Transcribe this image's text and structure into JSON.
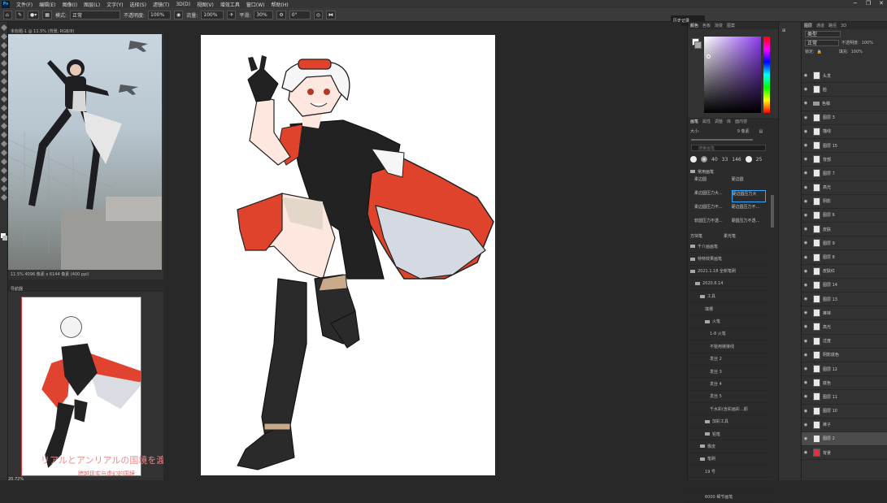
{
  "app": {
    "logo": "Ps"
  },
  "menu": [
    "文件(F)",
    "编辑(E)",
    "图像(I)",
    "图层(L)",
    "文字(Y)",
    "选择(S)",
    "滤镜(T)",
    "3D(D)",
    "视图(V)",
    "增效工具",
    "窗口(W)",
    "帮助(H)"
  ],
  "options": {
    "mode_label": "模式:",
    "mode_value": "正常",
    "opacity_label": "不透明度:",
    "opacity_value": "100%",
    "flow_label": "流量:",
    "flow_value": "100%",
    "smooth_label": "平滑:",
    "smooth_value": "30%",
    "angle_value": "0°"
  },
  "history_button": "历史记录",
  "ref_window": {
    "title": "未标题-1 @ 11.5% (背景, RGB/8)",
    "status": "11.5%   4096 像素 x 6144 像素 (400 ppi)"
  },
  "navigator": {
    "title": "导航器",
    "watermark_line1": "リアルとアンリアルの国境を渡り",
    "watermark_line2": "跨越现实与虚幻的国境",
    "zoom": "20.72%"
  },
  "color_panel": {
    "tabs": [
      "颜色",
      "色板",
      "渐变",
      "图案"
    ]
  },
  "brush_panel": {
    "tabs": [
      "画笔",
      "属性",
      "调整",
      "库",
      "面内容"
    ],
    "size_label": "大小:",
    "size_value": "9 像素",
    "search_placeholder": "搜索画笔",
    "preset_sizes": [
      "",
      "",
      "40",
      "33",
      "146",
      "",
      "25"
    ],
    "folder_top": "常用画笔",
    "grid": [
      "柔边圆",
      "硬边圆",
      "柔边圆压力大...",
      "硬边圆压力大",
      "柔边圆压力不...",
      "硬边圆压力不...",
      "软圆压力不透...",
      "硬圆压力不透..."
    ],
    "row2": [
      "方块笔",
      "柔光笔"
    ],
    "items": [
      "千介画画笔",
      "特特效果画笔",
      "2021.1.18 全新笔刷",
      "2020.6.14",
      "工具",
      "填槽",
      "火笔",
      "1-8 火笔",
      "不能用链接线",
      "发丝 2",
      "发丝 3",
      "发丝 4",
      "发丝 5",
      "千水彩(含彩画彩...颜",
      "加彩工具",
      "铅笔",
      "橡皮",
      "笔刷",
      "19 号",
      "尖涂",
      "6000 细节画笔"
    ]
  },
  "layers": {
    "tabs": [
      "图层",
      "通道",
      "路径",
      "3D"
    ],
    "kind": "类型",
    "blend": "正常",
    "opacity_label": "不透明度:",
    "opacity": "100%",
    "lock_label": "锁定:",
    "fill_label": "填充:",
    "fill": "100%",
    "rows": [
      "头发",
      "脸",
      "色稿",
      "图层 3",
      "描线",
      "图层 15",
      "背部",
      "图层 7",
      "高光",
      "阴影",
      "图层 6",
      "皮肤",
      "图层 9",
      "图层 8",
      "皮肤红",
      "图层 14",
      "图层 13",
      "裤袜",
      "高光",
      "过度",
      "阴影底色",
      "图层 12",
      "底色",
      "图层 11",
      "图层 10",
      "裤子",
      "图层 2",
      "背景"
    ]
  },
  "colors": {
    "accent": "#31a8ff",
    "selection": "#4b4b4b",
    "layer_bg_swatch": "#e0304a"
  }
}
